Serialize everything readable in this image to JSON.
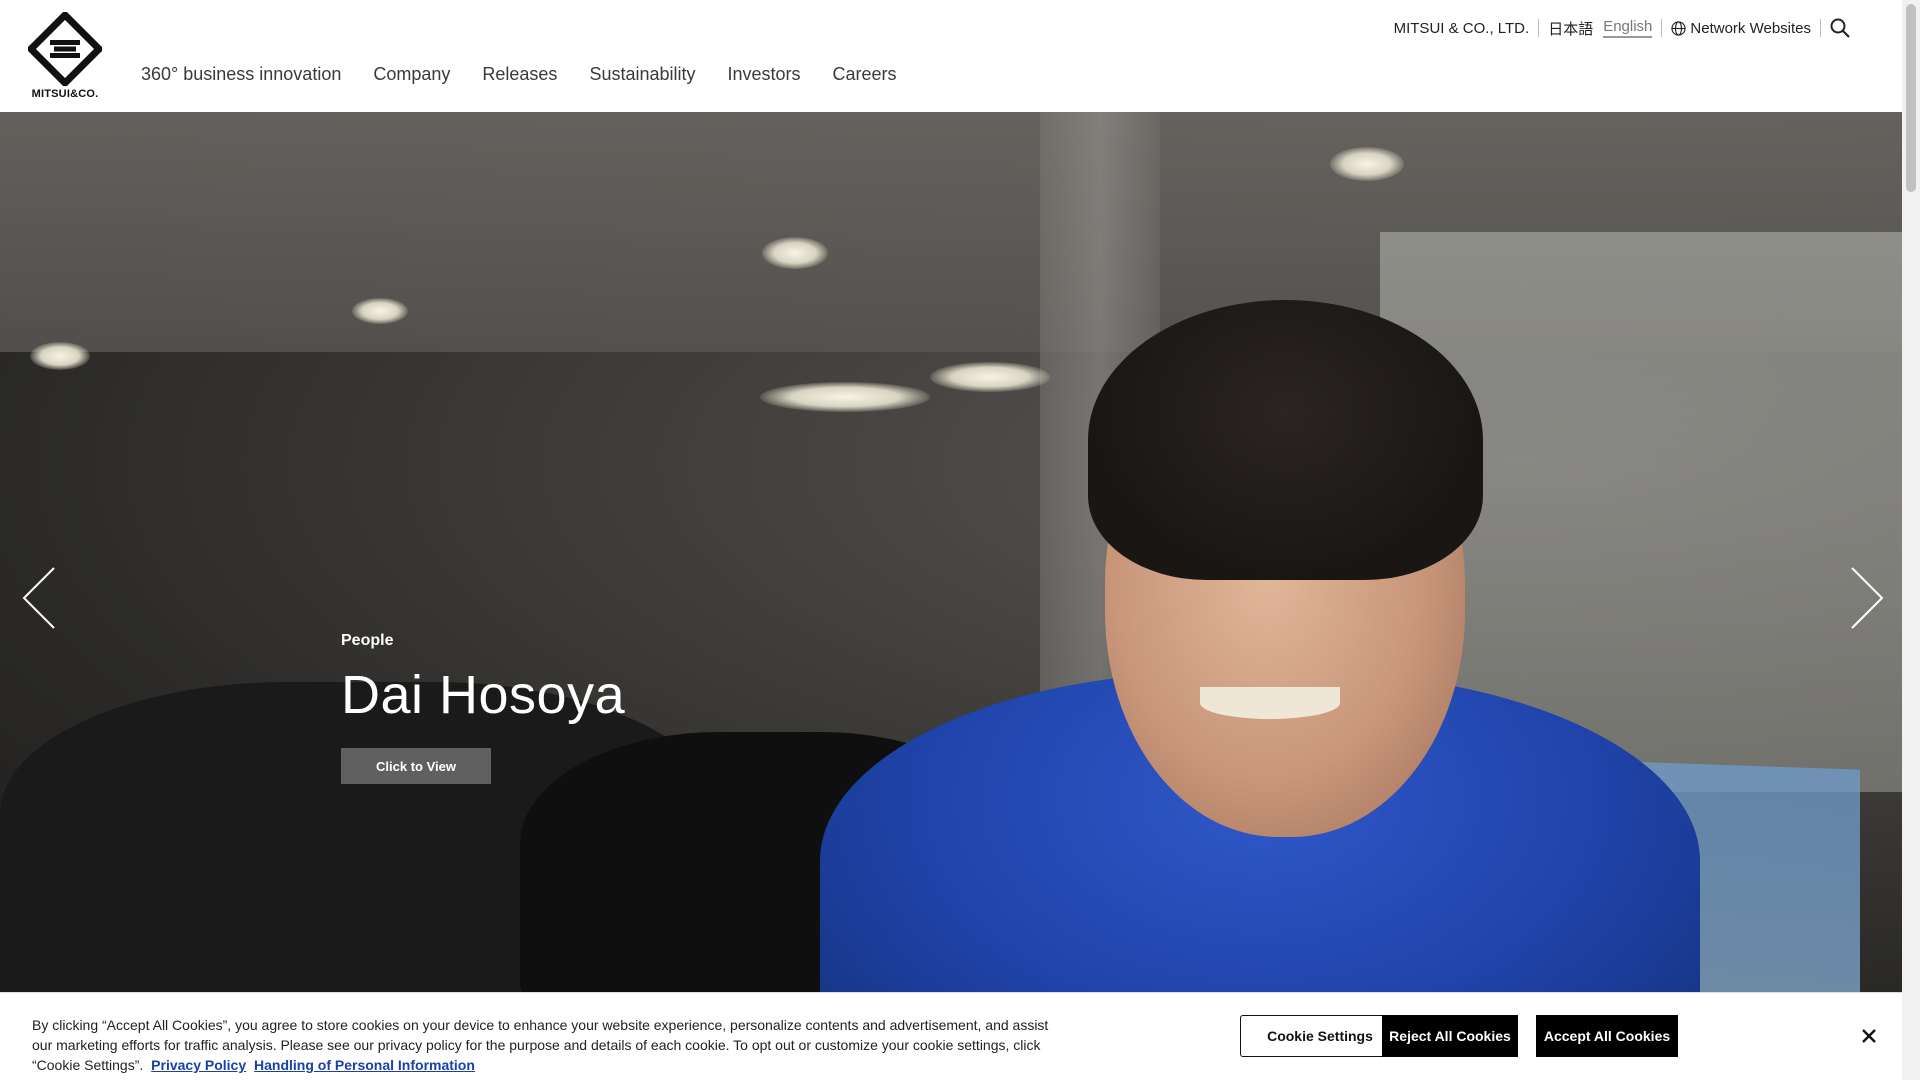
{
  "header": {
    "logo_text": "MITSUI&CO.",
    "nav": [
      {
        "label": "360° business innovation"
      },
      {
        "label": "Company"
      },
      {
        "label": "Releases"
      },
      {
        "label": "Sustainability"
      },
      {
        "label": "Investors"
      },
      {
        "label": "Careers"
      }
    ],
    "util": {
      "company_name": "MITSUI & CO., LTD.",
      "lang_ja": "日本語",
      "lang_en": "English",
      "network_label": "Network Websites",
      "globe_icon": "globe-icon",
      "search_icon": "search-icon"
    }
  },
  "hero": {
    "category": "People",
    "title": "Dai Hosoya",
    "cta_label": "Click to View",
    "prev_icon": "chevron-left-icon",
    "next_icon": "chevron-right-icon"
  },
  "cookie": {
    "text": "By clicking “Accept All Cookies”, you agree to store cookies on your device to enhance your website experience, personalize contents and advertisement, and assist our marketing efforts for traffic analysis. Please see our privacy policy for the purpose and details of each cookie. To opt out or customize your cookie settings, click “Cookie Settings”.",
    "privacy_link": "Privacy Policy",
    "personal_info_link": "Handling of Personal Information",
    "settings_label": "Cookie Settings",
    "reject_label": "Reject All Cookies",
    "accept_label": "Accept All Cookies",
    "close_icon": "close-icon"
  }
}
